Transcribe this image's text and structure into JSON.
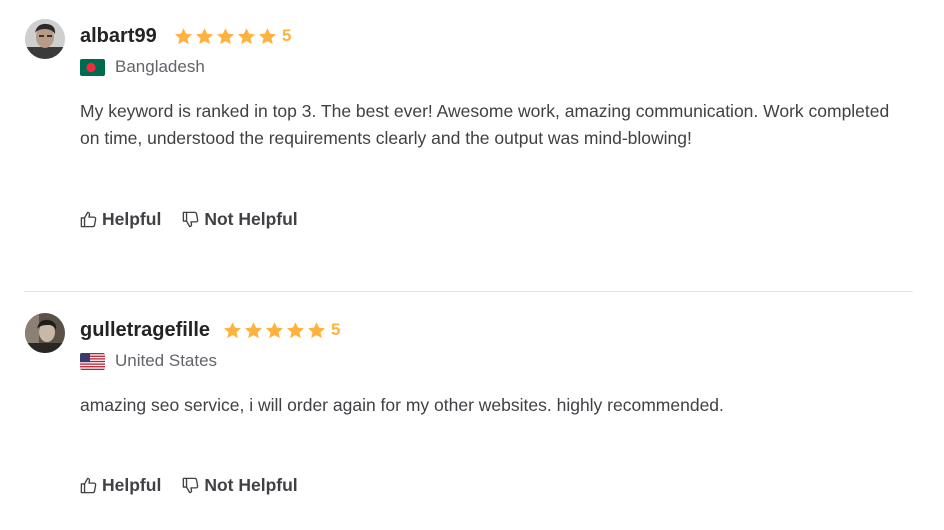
{
  "reviews": [
    {
      "username": "albart99",
      "rating": 5,
      "rating_label": "5",
      "country": "Bangladesh",
      "flag_icon": "bangladesh-flag-icon",
      "text": "My keyword is ranked in top 3. The best ever! Awesome work, amazing communication. Work completed on time, understood the requirements clearly and the output was mind-blowing!",
      "helpful_label": "Helpful",
      "not_helpful_label": "Not Helpful"
    },
    {
      "username": "gulletragefille",
      "rating": 5,
      "rating_label": "5",
      "country": "United States",
      "flag_icon": "usa-flag-icon",
      "text": "amazing seo service, i will order again for my other websites. highly recommended.",
      "helpful_label": "Helpful",
      "not_helpful_label": "Not Helpful"
    }
  ],
  "colors": {
    "star": "#ffb33e",
    "username": "#222325",
    "body_text": "#404145",
    "muted_text": "#62646a",
    "divider": "#e4e5e7"
  }
}
